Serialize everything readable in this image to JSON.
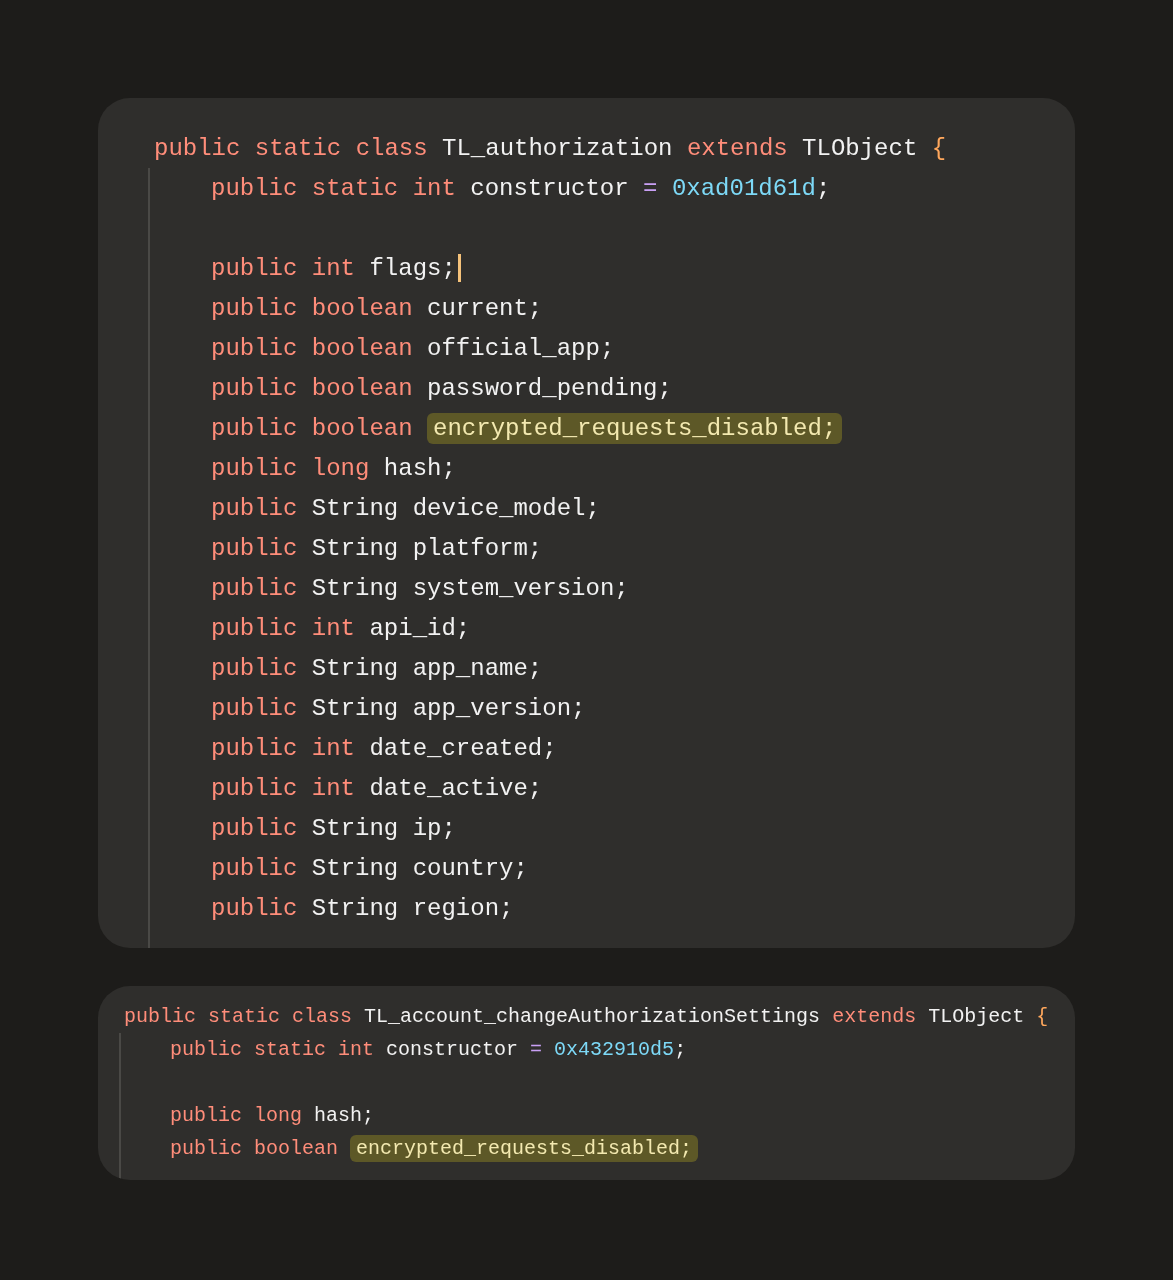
{
  "blocks": [
    {
      "kind": "large",
      "lines": [
        {
          "kind": "code",
          "tokens": [
            {
              "kind": "keyword",
              "text": "public static class "
            },
            {
              "kind": "ident",
              "text": "TL_authorization "
            },
            {
              "kind": "keyword",
              "text": "extends "
            },
            {
              "kind": "ident",
              "text": "TLObject "
            },
            {
              "kind": "brace",
              "text": "{"
            }
          ],
          "children": [
            {
              "kind": "code",
              "tokens": [
                {
                  "kind": "keyword",
                  "text": "public static int "
                },
                {
                  "kind": "ident",
                  "text": "constructor "
                },
                {
                  "kind": "operator",
                  "text": "= "
                },
                {
                  "kind": "number",
                  "text": "0xad01d61d"
                },
                {
                  "kind": "ident",
                  "text": ";"
                }
              ]
            },
            {
              "kind": "blank"
            },
            {
              "kind": "code",
              "tokens": [
                {
                  "kind": "keyword",
                  "text": "public int "
                },
                {
                  "kind": "ident",
                  "text": "flags;"
                }
              ],
              "caret": true
            },
            {
              "kind": "code",
              "tokens": [
                {
                  "kind": "keyword",
                  "text": "public boolean "
                },
                {
                  "kind": "ident",
                  "text": "current;"
                }
              ]
            },
            {
              "kind": "code",
              "tokens": [
                {
                  "kind": "keyword",
                  "text": "public boolean "
                },
                {
                  "kind": "ident",
                  "text": "official_app;"
                }
              ]
            },
            {
              "kind": "code",
              "tokens": [
                {
                  "kind": "keyword",
                  "text": "public boolean "
                },
                {
                  "kind": "ident",
                  "text": "password_pending;"
                }
              ]
            },
            {
              "kind": "code",
              "tokens": [
                {
                  "kind": "keyword",
                  "text": "public boolean "
                },
                {
                  "kind": "ident",
                  "text": "encrypted_requests_disabled;",
                  "highlighted": true
                }
              ]
            },
            {
              "kind": "code",
              "tokens": [
                {
                  "kind": "keyword",
                  "text": "public long "
                },
                {
                  "kind": "ident",
                  "text": "hash;"
                }
              ]
            },
            {
              "kind": "code",
              "tokens": [
                {
                  "kind": "keyword",
                  "text": "public "
                },
                {
                  "kind": "ident",
                  "text": "String device_model;"
                }
              ]
            },
            {
              "kind": "code",
              "tokens": [
                {
                  "kind": "keyword",
                  "text": "public "
                },
                {
                  "kind": "ident",
                  "text": "String platform;"
                }
              ]
            },
            {
              "kind": "code",
              "tokens": [
                {
                  "kind": "keyword",
                  "text": "public "
                },
                {
                  "kind": "ident",
                  "text": "String system_version;"
                }
              ]
            },
            {
              "kind": "code",
              "tokens": [
                {
                  "kind": "keyword",
                  "text": "public int "
                },
                {
                  "kind": "ident",
                  "text": "api_id;"
                }
              ]
            },
            {
              "kind": "code",
              "tokens": [
                {
                  "kind": "keyword",
                  "text": "public "
                },
                {
                  "kind": "ident",
                  "text": "String app_name;"
                }
              ]
            },
            {
              "kind": "code",
              "tokens": [
                {
                  "kind": "keyword",
                  "text": "public "
                },
                {
                  "kind": "ident",
                  "text": "String app_version;"
                }
              ]
            },
            {
              "kind": "code",
              "tokens": [
                {
                  "kind": "keyword",
                  "text": "public int "
                },
                {
                  "kind": "ident",
                  "text": "date_created;"
                }
              ]
            },
            {
              "kind": "code",
              "tokens": [
                {
                  "kind": "keyword",
                  "text": "public int "
                },
                {
                  "kind": "ident",
                  "text": "date_active;"
                }
              ]
            },
            {
              "kind": "code",
              "tokens": [
                {
                  "kind": "keyword",
                  "text": "public "
                },
                {
                  "kind": "ident",
                  "text": "String ip;"
                }
              ]
            },
            {
              "kind": "code",
              "tokens": [
                {
                  "kind": "keyword",
                  "text": "public "
                },
                {
                  "kind": "ident",
                  "text": "String country;"
                }
              ]
            },
            {
              "kind": "code",
              "tokens": [
                {
                  "kind": "keyword",
                  "text": "public "
                },
                {
                  "kind": "ident",
                  "text": "String region;"
                }
              ]
            }
          ]
        }
      ]
    },
    {
      "kind": "compact",
      "lines": [
        {
          "kind": "code",
          "tokens": [
            {
              "kind": "keyword",
              "text": "public static class "
            },
            {
              "kind": "ident",
              "text": "TL_account_changeAuthorizationSettings "
            },
            {
              "kind": "keyword",
              "text": "extends "
            },
            {
              "kind": "ident",
              "text": "TLObject "
            },
            {
              "kind": "brace",
              "text": "{"
            }
          ],
          "children": [
            {
              "kind": "code",
              "tokens": [
                {
                  "kind": "keyword",
                  "text": "public static int "
                },
                {
                  "kind": "ident",
                  "text": "constructor "
                },
                {
                  "kind": "operator",
                  "text": "= "
                },
                {
                  "kind": "number",
                  "text": "0x432910d5"
                },
                {
                  "kind": "ident",
                  "text": ";"
                }
              ]
            },
            {
              "kind": "blank"
            },
            {
              "kind": "code",
              "tokens": [
                {
                  "kind": "keyword",
                  "text": "public long "
                },
                {
                  "kind": "ident",
                  "text": "hash;"
                }
              ]
            },
            {
              "kind": "code",
              "tokens": [
                {
                  "kind": "keyword",
                  "text": "public boolean "
                },
                {
                  "kind": "ident",
                  "text": "encrypted_requests_disabled;",
                  "highlighted": true
                }
              ]
            }
          ]
        }
      ]
    }
  ]
}
